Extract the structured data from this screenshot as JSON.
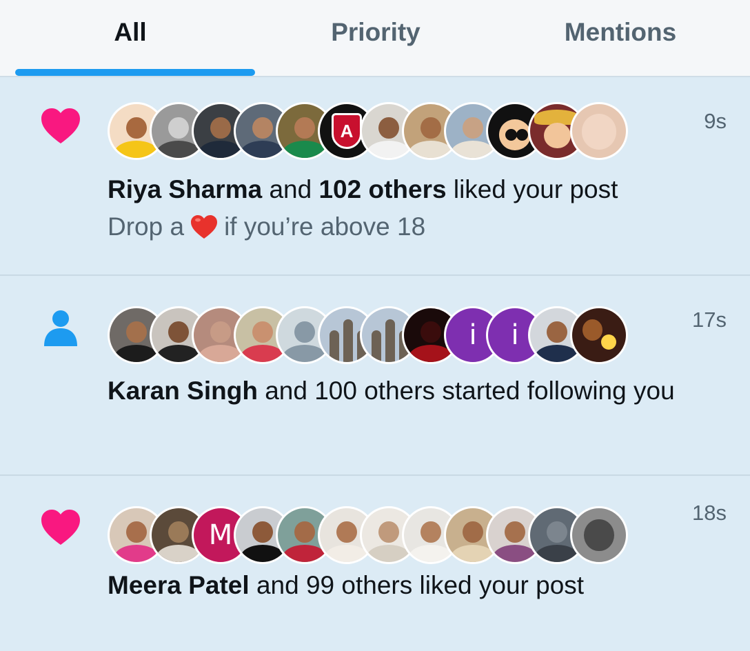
{
  "tabs": [
    {
      "label": "All",
      "active": true
    },
    {
      "label": "Priority",
      "active": false
    },
    {
      "label": "Mentions",
      "active": false
    }
  ],
  "colors": {
    "accent": "#1d9bf0",
    "like": "#f91880",
    "follow": "#1d9bf0",
    "background": "#dcebf5",
    "secondary_text": "#536471"
  },
  "notifications": [
    {
      "type": "like",
      "icon": "heart-icon",
      "time": "9s",
      "actor": "Riya Sharma",
      "connector": " and ",
      "others": "102 others",
      "action": " liked your post",
      "preview": {
        "before": "Drop a",
        "emoji": "red-heart-emoji",
        "after": "if you’re above 18"
      }
    },
    {
      "type": "follow",
      "icon": "person-icon",
      "time": "17s",
      "actor": "Karan Singh",
      "connector": " and 100 others started following you"
    },
    {
      "type": "like",
      "icon": "heart-icon",
      "time": "18s",
      "actor": "Meera Patel",
      "connector": " and 99 others liked your post"
    }
  ],
  "avatar_letters": {
    "a6": "A",
    "b10": "i",
    "b11": "i",
    "c3": "M"
  }
}
